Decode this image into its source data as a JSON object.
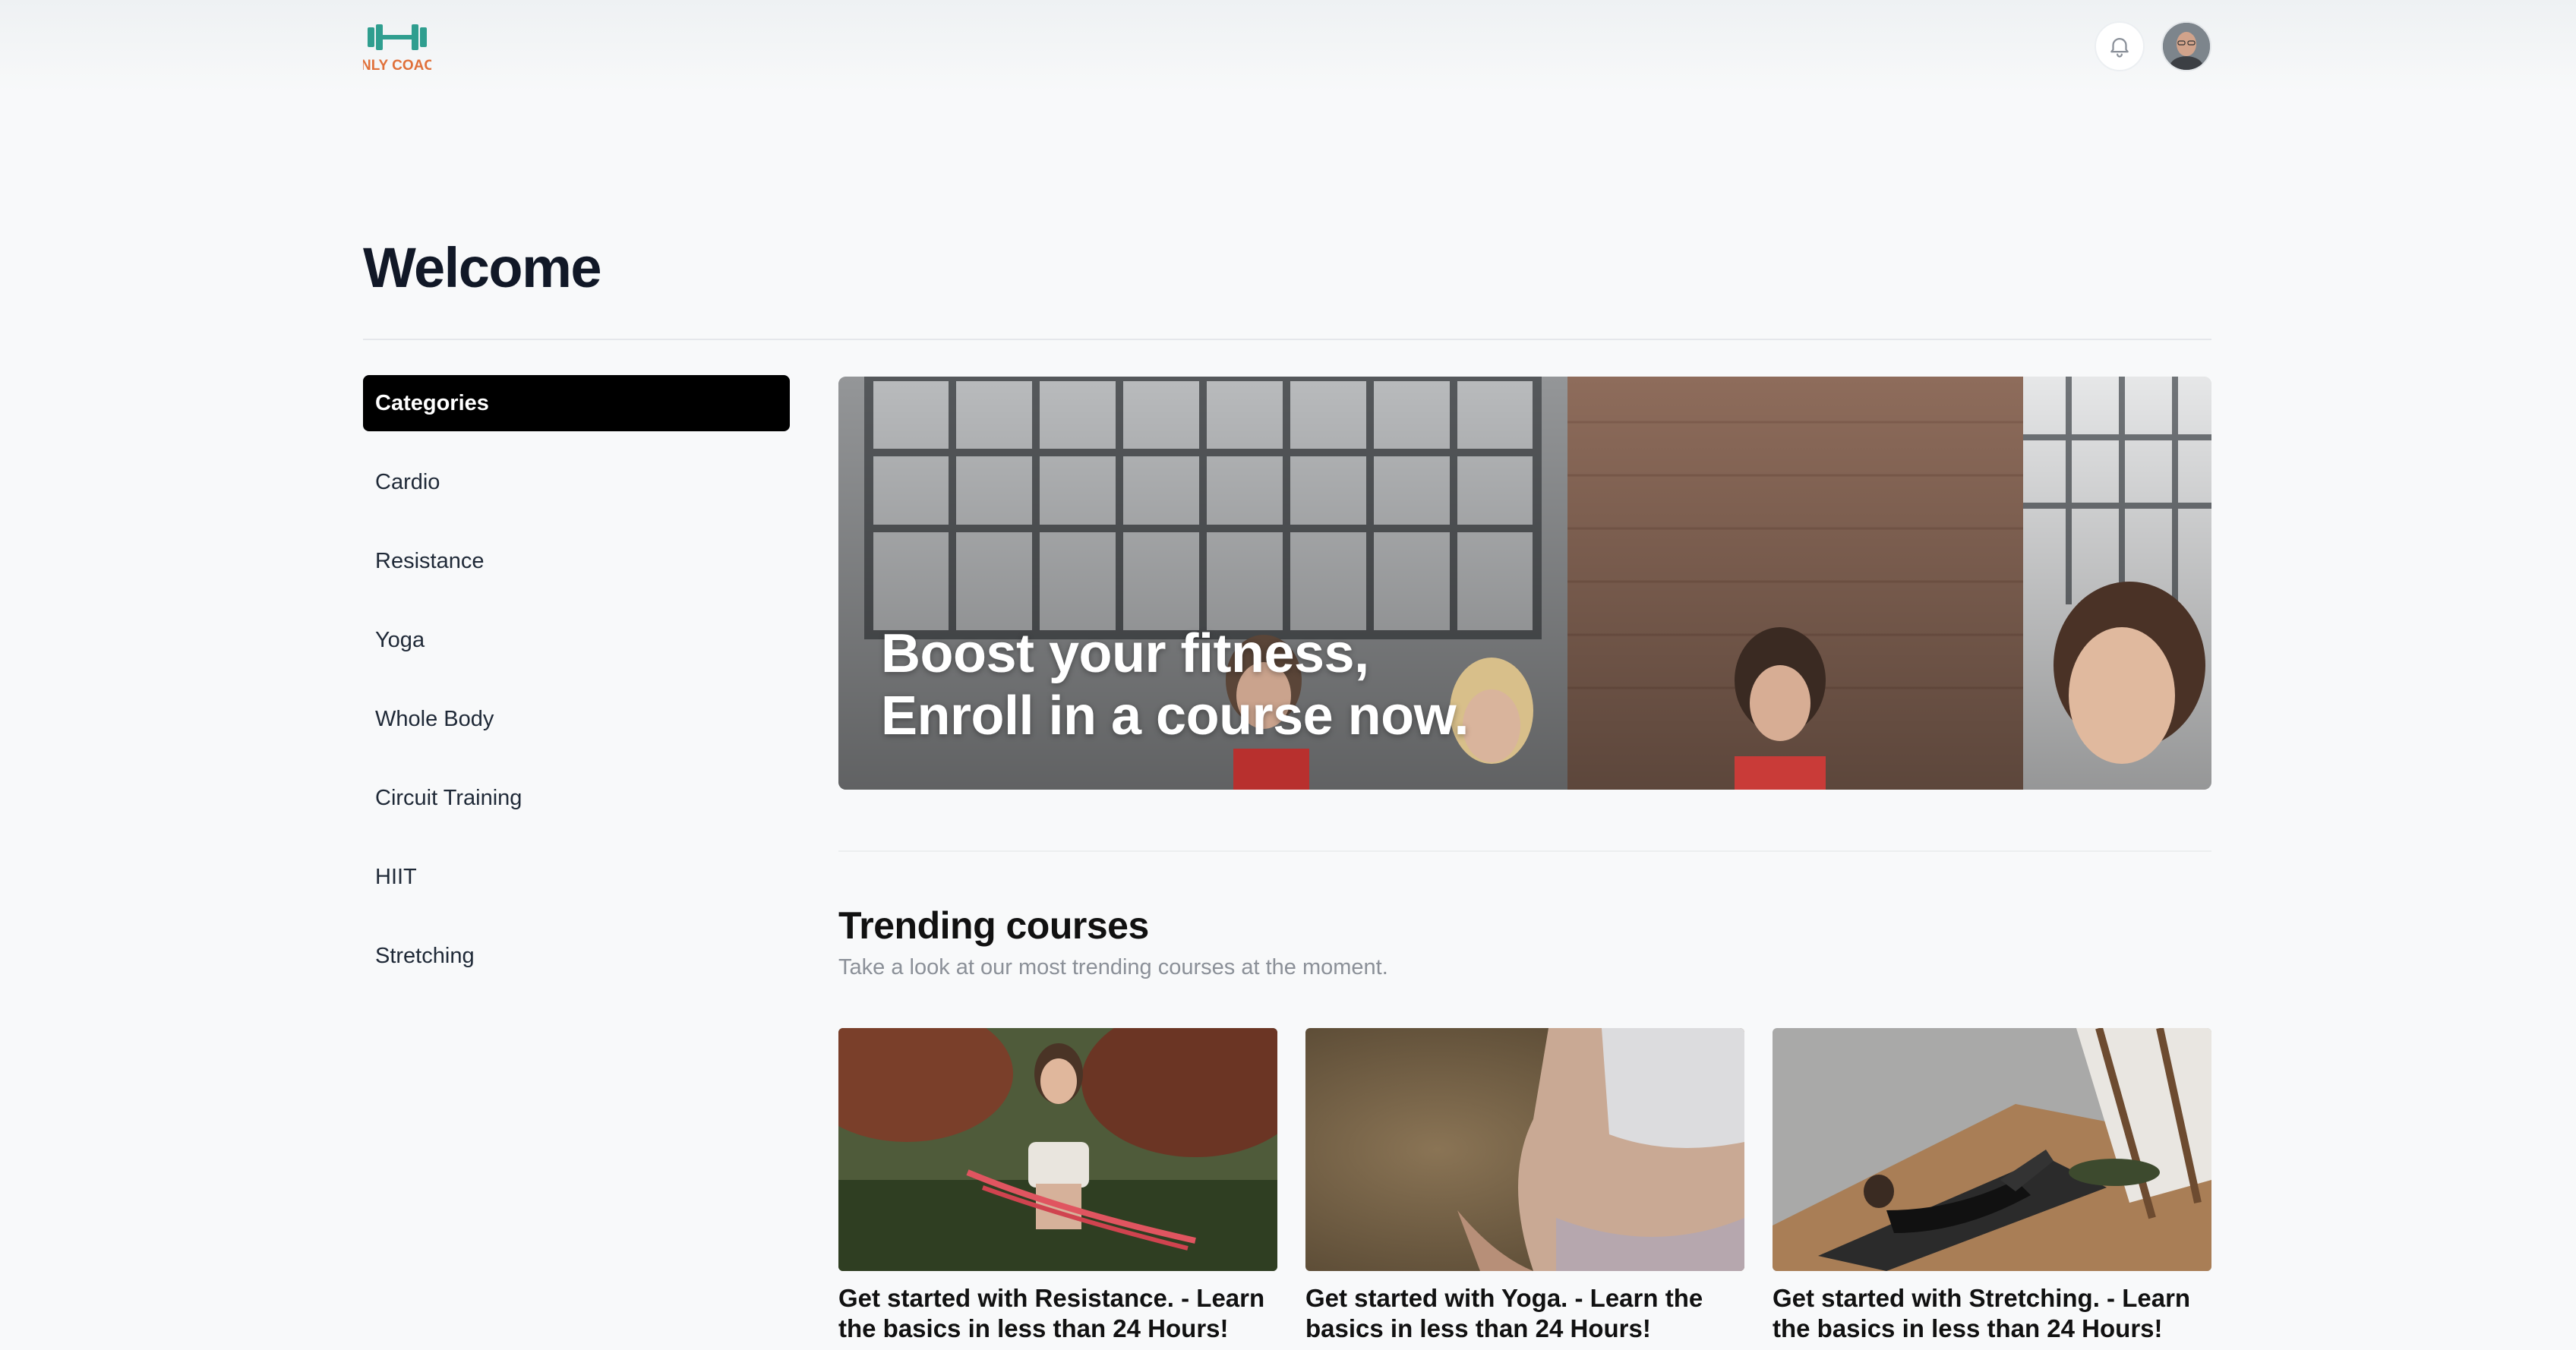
{
  "header": {
    "logo_text": "ONLY COACH",
    "icons": [
      "bell-icon",
      "avatar"
    ]
  },
  "page": {
    "title": "Welcome"
  },
  "sidebar": {
    "items": [
      {
        "label": "Categories",
        "active": true
      },
      {
        "label": "Cardio"
      },
      {
        "label": "Resistance"
      },
      {
        "label": "Yoga"
      },
      {
        "label": "Whole Body"
      },
      {
        "label": "Circuit Training"
      },
      {
        "label": "HIIT"
      },
      {
        "label": "Stretching"
      }
    ]
  },
  "hero": {
    "line1": "Boost your fitness,",
    "line2": "Enroll in a course now."
  },
  "trending": {
    "title": "Trending courses",
    "subtitle": "Take a look at our most trending courses at the moment.",
    "courses": [
      {
        "title": "Get started with Resistance. - Learn the basics in less than 24 Hours!"
      },
      {
        "title": "Get started with Yoga. - Learn the basics in less than 24 Hours!"
      },
      {
        "title": "Get started with Stretching. - Learn the basics in less than 24 Hours!"
      }
    ]
  },
  "colors": {
    "logo_teal": "#2f9e8f",
    "logo_orange": "#e0703a",
    "active_bg": "#000000",
    "page_bg": "#f8f9fa"
  }
}
